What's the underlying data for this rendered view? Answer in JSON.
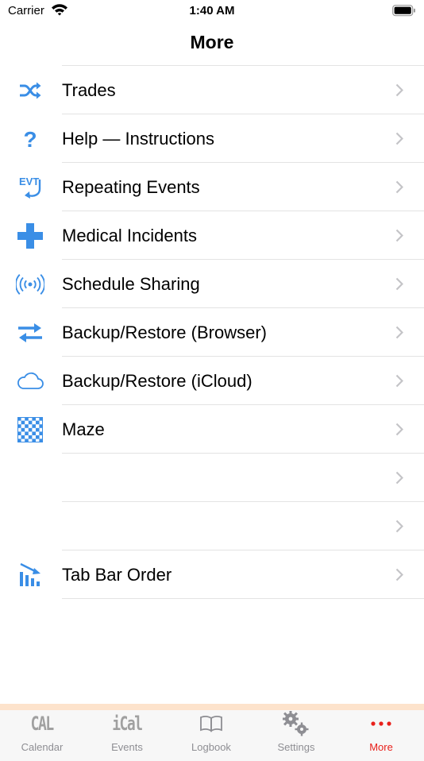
{
  "status_bar": {
    "carrier": "Carrier",
    "time": "1:40 AM"
  },
  "nav": {
    "title": "More"
  },
  "accent_color": "#3a8ee6",
  "menu_items": [
    {
      "label": "Trades",
      "icon": "shuffle-icon"
    },
    {
      "label": "Help — Instructions",
      "icon": "question-mark-icon"
    },
    {
      "label": "Repeating Events",
      "icon": "evt-repeat-icon"
    },
    {
      "label": "Medical Incidents",
      "icon": "medical-cross-icon"
    },
    {
      "label": "Schedule Sharing",
      "icon": "broadcast-icon"
    },
    {
      "label": "Backup/Restore (Browser)",
      "icon": "transfer-arrows-icon"
    },
    {
      "label": "Backup/Restore (iCloud)",
      "icon": "cloud-icon"
    },
    {
      "label": "Maze",
      "icon": "maze-grid-icon"
    },
    {
      "label": "",
      "icon": ""
    },
    {
      "label": "",
      "icon": ""
    },
    {
      "label": "Tab Bar Order",
      "icon": "bar-chart-down-icon"
    }
  ],
  "tab_bar": {
    "active_color": "#e8201b",
    "tabs": [
      {
        "label": "Calendar",
        "icon_text": "CAL"
      },
      {
        "label": "Events",
        "icon_text": "iCal"
      },
      {
        "label": "Logbook",
        "icon": "book-icon"
      },
      {
        "label": "Settings",
        "icon": "gears-icon"
      },
      {
        "label": "More",
        "icon": "more-dots-icon"
      }
    ]
  }
}
